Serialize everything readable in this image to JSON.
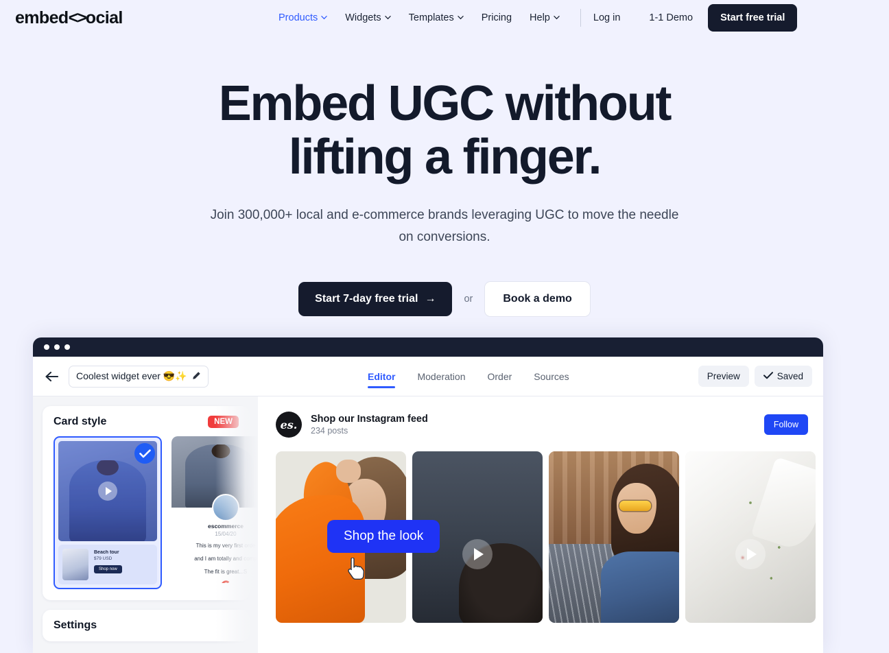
{
  "brand": {
    "logo_text_1": "embed",
    "logo_chevrons": "<>",
    "logo_text_2": "ocial"
  },
  "nav": {
    "items": [
      {
        "label": "Products",
        "has_caret": true,
        "active": true
      },
      {
        "label": "Widgets",
        "has_caret": true,
        "active": false
      },
      {
        "label": "Templates",
        "has_caret": true,
        "active": false
      },
      {
        "label": "Pricing",
        "has_caret": false,
        "active": false
      },
      {
        "label": "Help",
        "has_caret": true,
        "active": false
      }
    ],
    "login": "Log in",
    "demo": "1-1 Demo",
    "cta": "Start free trial"
  },
  "hero": {
    "title_line1": "Embed UGC without",
    "title_line2": "lifting a finger.",
    "subtitle": "Join 300,000+ local and e-commerce brands leveraging UGC to move the needle on conversions.",
    "primary_cta": "Start 7-day free trial",
    "primary_cta_arrow": "→",
    "or": "or",
    "secondary_cta": "Book a demo"
  },
  "app": {
    "widget_title": "Coolest widget ever 😎✨",
    "tabs": [
      {
        "label": "Editor",
        "selected": true
      },
      {
        "label": "Moderation",
        "selected": false
      },
      {
        "label": "Order",
        "selected": false
      },
      {
        "label": "Sources",
        "selected": false
      }
    ],
    "preview_label": "Preview",
    "saved_label": "Saved",
    "card_style": {
      "title": "Card style",
      "badge": "NEW",
      "option_1_selected": true,
      "product": {
        "title": "Beach tour",
        "price": "$79 USD",
        "button": "Shop now"
      },
      "review": {
        "author": "escommerce",
        "date": "15/04/20",
        "line1": "This is my very first orde",
        "line2": "and I am totally and comp",
        "line3": "The fit is great...S"
      }
    },
    "settings": {
      "title": "Settings"
    },
    "preview": {
      "feed_avatar_text": "es.",
      "feed_title": "Shop our Instagram feed",
      "feed_count": "234 posts",
      "follow_label": "Follow",
      "shop_the_look": "Shop the look",
      "tiles": [
        {
          "name": "woman-orange-top",
          "has_play": false
        },
        {
          "name": "dark-portrait-video",
          "has_play": true
        },
        {
          "name": "woman-yellow-sunglasses-denim",
          "has_play": false
        },
        {
          "name": "white-embroidered-garment-video",
          "has_play": true
        }
      ]
    }
  },
  "colors": {
    "page_bg": "#f1f2fe",
    "ink": "#131a2b",
    "accent_blue": "#2f5bff",
    "follow_blue": "#1f47f5",
    "pill_blue": "#1f33f5",
    "badge_red": "#f03c3c",
    "dark_btn": "#151b2d"
  }
}
